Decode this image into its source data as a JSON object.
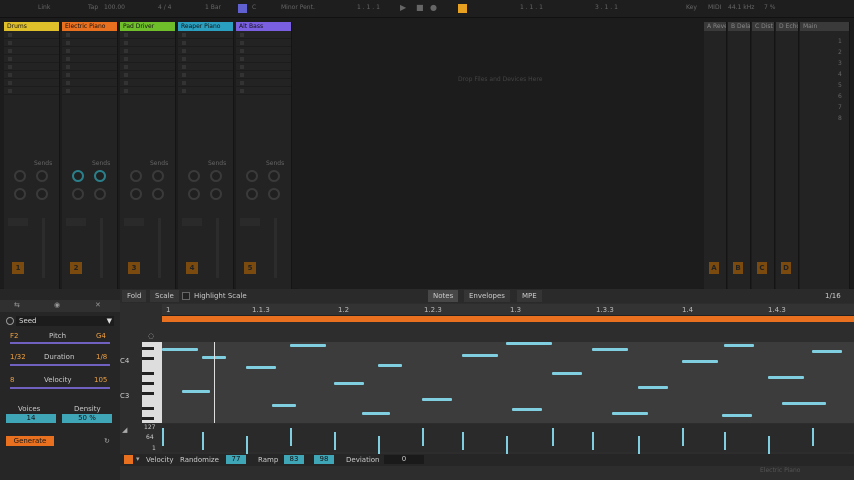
{
  "topbar": {
    "link": "Link",
    "tap": "Tap",
    "tempo": "100.00",
    "time_sig": "4 / 4",
    "quant": "1 Bar",
    "key": "C",
    "scale": "Minor Pent.",
    "position": "1 . 1 . 1",
    "loop_start": "1 . 1 . 1",
    "loop_len": "3 . 1 . 1",
    "key_label": "Key",
    "midi_label": "MIDI",
    "sample_rate": "44.1 kHz",
    "cpu": "7 %"
  },
  "tracks": [
    {
      "name": "Drums",
      "color": "#e0c02a",
      "num": "1"
    },
    {
      "name": "Electric Piano",
      "color": "#e8701f",
      "num": "2"
    },
    {
      "name": "Pad Driver",
      "color": "#6fbf2a",
      "num": "3"
    },
    {
      "name": "Reaper Piano",
      "color": "#2a9fbf",
      "num": "4"
    },
    {
      "name": "Alt Bass",
      "color": "#7a5fe0",
      "num": "5"
    }
  ],
  "returns": [
    {
      "name": "A Reverb",
      "letter": "A"
    },
    {
      "name": "B Delay",
      "letter": "B"
    },
    {
      "name": "C Dist",
      "letter": "C"
    },
    {
      "name": "D Echo",
      "letter": "D"
    }
  ],
  "main_label": "Main",
  "scene_numbers": [
    "1",
    "2",
    "3",
    "4",
    "5",
    "6",
    "7",
    "8"
  ],
  "sends_label": "Sends",
  "drop_text": "Drop Files and Devices Here",
  "generator": {
    "seed_label": "Seed",
    "pitch_label": "Pitch",
    "pitch_low": "F2",
    "pitch_high": "G4",
    "duration_label": "Duration",
    "duration_low": "1/32",
    "duration_high": "1/8",
    "velocity_label": "Velocity",
    "velocity_low": "8",
    "velocity_high": "105",
    "voices_label": "Voices",
    "voices_value": "14",
    "density_label": "Density",
    "density_value": "50 %",
    "generate_label": "Generate"
  },
  "editor": {
    "fold": "Fold",
    "scale": "Scale",
    "highlight_scale": "Highlight Scale",
    "tab_notes": "Notes",
    "tab_envelopes": "Envelopes",
    "tab_mpe": "MPE",
    "grid": "1/16",
    "ruler": [
      "1",
      "1.1.3",
      "1.2",
      "1.2.3",
      "1.3",
      "1.3.3",
      "1.4",
      "1.4.3"
    ],
    "pitch_c4": "C4",
    "pitch_c3": "C3",
    "vel_127": "127",
    "vel_64": "64",
    "vel_1": "1"
  },
  "footer": {
    "velocity_label": "Velocity",
    "randomize_label": "Randomize",
    "randomize_value": "77",
    "ramp_label": "Ramp",
    "ramp_start": "83",
    "ramp_end": "98",
    "deviation_label": "Deviation",
    "deviation_value": "0"
  },
  "status": {
    "clip_name": "Electric Piano"
  },
  "colors": {
    "accent": "#e8701f",
    "note": "#7fcfe0",
    "teal_box": "#3fa6b8"
  }
}
